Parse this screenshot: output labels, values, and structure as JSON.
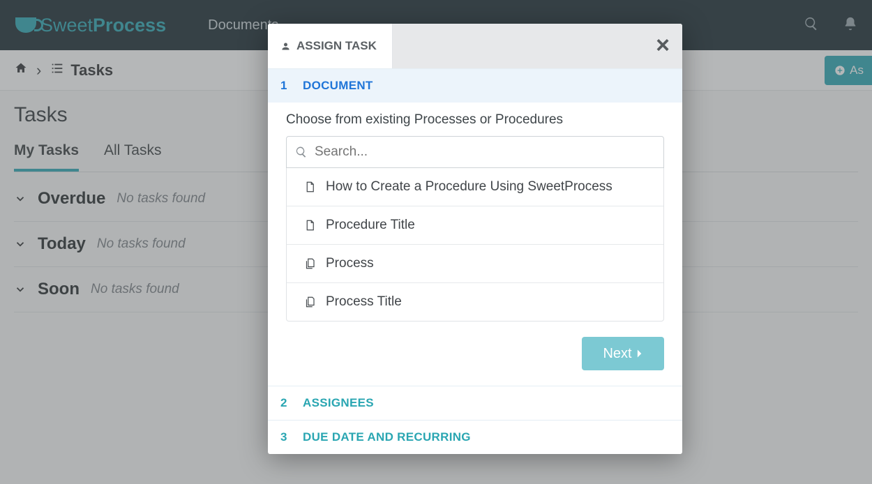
{
  "brand": {
    "light": "Sweet",
    "bold": "Process"
  },
  "nav": {
    "documents": "Documents"
  },
  "breadcrumb": {
    "tasks": "Tasks"
  },
  "assign_button": "As",
  "page": {
    "title": "Tasks"
  },
  "tabs": {
    "my": "My Tasks",
    "all": "All Tasks"
  },
  "sections": {
    "overdue": {
      "title": "Overdue",
      "empty": "No tasks found"
    },
    "today": {
      "title": "Today",
      "empty": "No tasks found"
    },
    "soon": {
      "title": "Soon",
      "empty": "No tasks found"
    }
  },
  "modal": {
    "tab_label": "ASSIGN TASK",
    "steps": {
      "s1": {
        "num": "1",
        "label": "DOCUMENT"
      },
      "s2": {
        "num": "2",
        "label": "ASSIGNEES"
      },
      "s3": {
        "num": "3",
        "label": "DUE DATE AND RECURRING"
      }
    },
    "choose_label": "Choose from existing Processes or Procedures",
    "search_placeholder": "Search...",
    "docs": [
      "How to Create a Procedure Using SweetProcess",
      "Procedure Title",
      "Process",
      "Process Title"
    ],
    "next": "Next"
  }
}
